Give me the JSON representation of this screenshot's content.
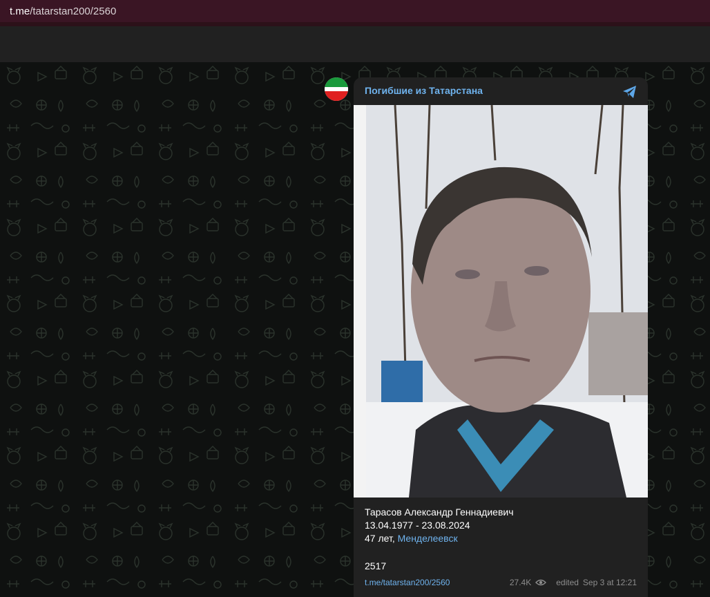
{
  "browser": {
    "url_host": "t.me",
    "url_path": "/tatarstan200/2560"
  },
  "post": {
    "channel_name": "Погибшие из Татарстана",
    "name": "Тарасов Александр Геннадиевич",
    "dates": "13.04.1977 - 23.08.2024",
    "age_prefix": "47 лет, ",
    "place_link": "Менделеевск",
    "number": "2517",
    "link": "t.me/tatarstan200/2560",
    "views": "27.4K",
    "edited": "edited",
    "timestamp": "Sep 3 at 12:21"
  },
  "icons": {
    "telegram": "telegram-plane-icon",
    "views": "eye-icon",
    "avatar": "tatarstan-flag-avatar"
  },
  "colors": {
    "accent": "#6fb3ee",
    "urlbar": "#3a1524",
    "bubble": "#212121",
    "background": "#0f1110"
  }
}
